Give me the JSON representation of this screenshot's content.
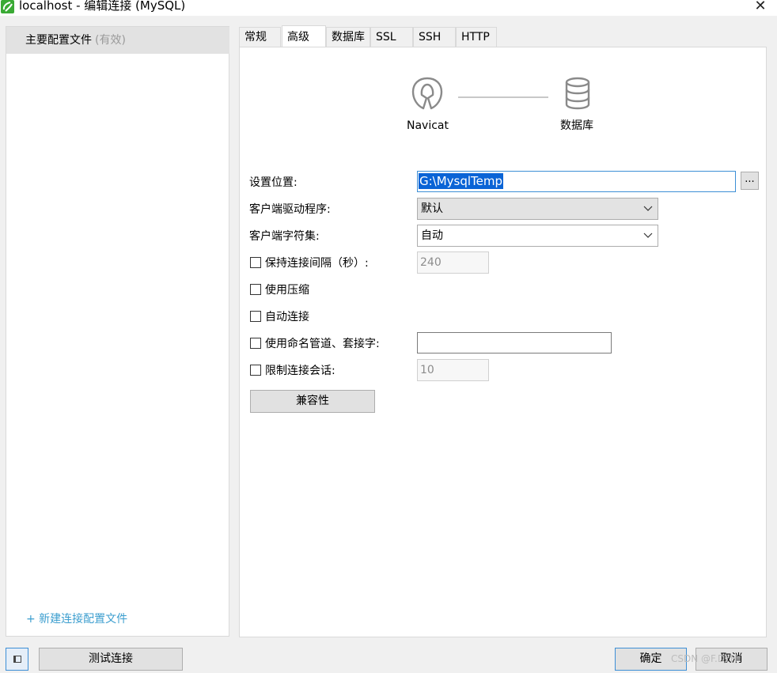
{
  "window": {
    "title": "localhost - 编辑连接 (MySQL)",
    "close_glyph": "✕"
  },
  "sidebar": {
    "profile": {
      "label": "主要配置文件",
      "status": "(有效)"
    },
    "new_profile_link": "+ 新建连接配置文件"
  },
  "tabs": [
    {
      "label": "常规",
      "active": false
    },
    {
      "label": "高级",
      "active": true
    },
    {
      "label": "数据库",
      "active": false
    },
    {
      "label": "SSL",
      "active": false
    },
    {
      "label": "SSH",
      "active": false
    },
    {
      "label": "HTTP",
      "active": false
    }
  ],
  "diagram": {
    "left_label": "Navicat",
    "right_label": "数据库"
  },
  "form": {
    "location_label": "设置位置:",
    "location_value": "G:\\MysqlTemp",
    "browse_label": "...",
    "driver_label": "客户端驱动程序:",
    "driver_value": "默认",
    "charset_label": "客户端字符集:",
    "charset_value": "自动",
    "keepalive_label": "保持连接间隔（秒）:",
    "keepalive_value": "240",
    "keepalive_checked": false,
    "compress_label": "使用压缩",
    "compress_checked": false,
    "autoconnect_label": "自动连接",
    "autoconnect_checked": false,
    "namedpipe_label": "使用命名管道、套接字:",
    "namedpipe_value": "",
    "namedpipe_checked": false,
    "limitsession_label": "限制连接会话:",
    "limitsession_value": "10",
    "limitsession_checked": false,
    "compat_button": "兼容性"
  },
  "footer": {
    "test_button": "测试连接",
    "ok_button": "确定",
    "cancel_button": "取消",
    "watermark": "CSDN @F.DYH"
  },
  "colors": {
    "accent": "#0a64d6",
    "link": "#3c9ecf",
    "app_icon": "#3aaa35"
  }
}
